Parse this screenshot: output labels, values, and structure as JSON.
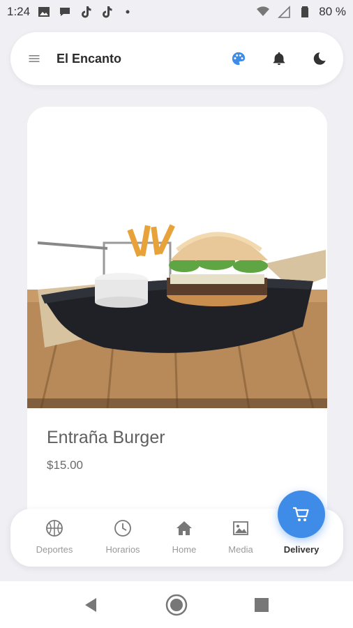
{
  "status_bar": {
    "time": "1:24",
    "battery": "80 %",
    "icons": [
      "image-icon",
      "chat-bubble-icon",
      "tiktok-icon",
      "tiktok-icon",
      "dot-icon",
      "wifi-icon",
      "signal-icon",
      "battery-icon"
    ]
  },
  "header": {
    "title": "El Encanto",
    "icons": [
      "hamburger-menu-icon",
      "palette-icon",
      "bell-icon",
      "moon-icon"
    ],
    "accent_color": "#3f8ce8"
  },
  "product": {
    "name": "Entraña Burger",
    "price": "$15.00",
    "image": "burger-with-fries-photo"
  },
  "bottom_nav": {
    "items": [
      {
        "label": "Deportes",
        "icon": "basketball-icon"
      },
      {
        "label": "Horarios",
        "icon": "clock-icon"
      },
      {
        "label": "Home",
        "icon": "home-icon"
      },
      {
        "label": "Media",
        "icon": "image-icon"
      },
      {
        "label": "Delivery",
        "icon": "cart-icon",
        "active": true
      }
    ]
  },
  "system_nav": {
    "icons": [
      "back-icon",
      "home-circle-icon",
      "recents-icon"
    ]
  }
}
